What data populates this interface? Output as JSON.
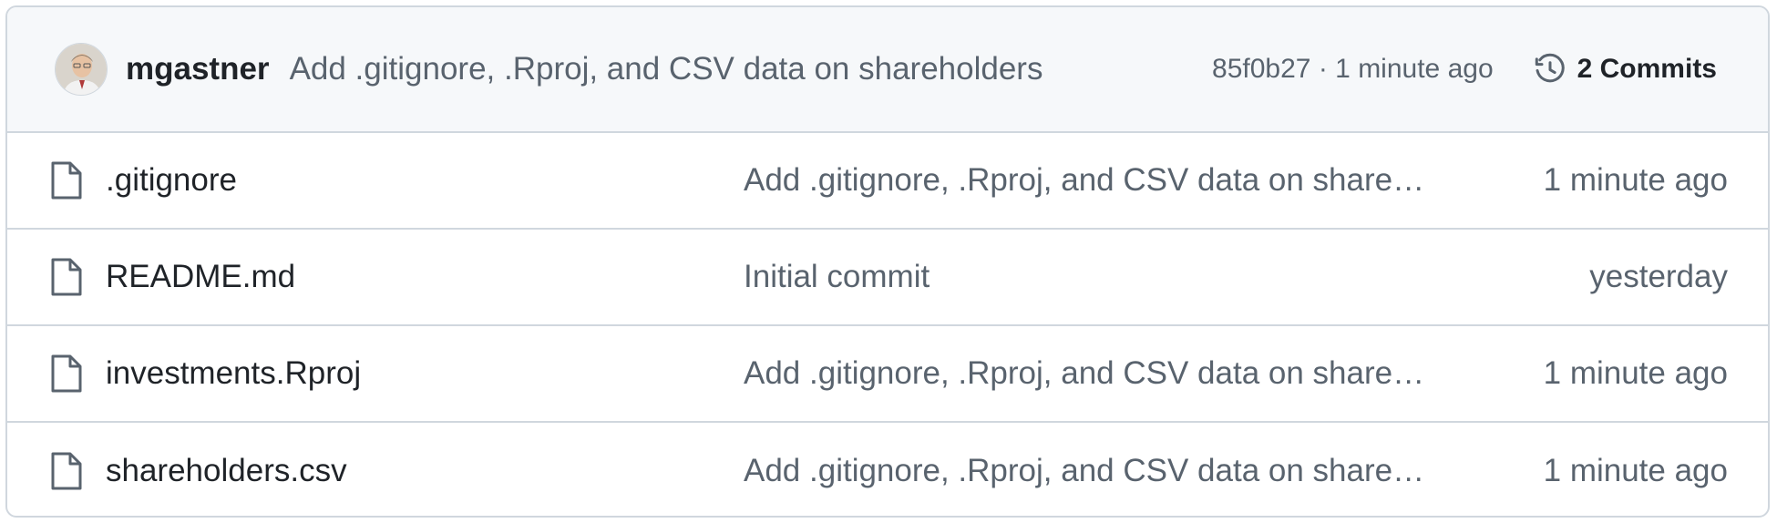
{
  "latest_commit": {
    "author": "mgastner",
    "message": "Add .gitignore, .Rproj, and CSV data on shareholders",
    "sha": "85f0b27",
    "separator": " · ",
    "time": "1 minute ago",
    "commits_count": "2 Commits",
    "avatar_icon": "avatar-photo",
    "history_icon": "history-icon"
  },
  "files": [
    {
      "name": ".gitignore",
      "message": "Add .gitignore, .Rproj, and CSV data on shareholders",
      "time": "1 minute ago",
      "icon": "file-icon"
    },
    {
      "name": "README.md",
      "message": "Initial commit",
      "time": "yesterday",
      "icon": "file-icon"
    },
    {
      "name": "investments.Rproj",
      "message": "Add .gitignore, .Rproj, and CSV data on shareholders",
      "time": "1 minute ago",
      "icon": "file-icon"
    },
    {
      "name": "shareholders.csv",
      "message": "Add .gitignore, .Rproj, and CSV data on shareholders",
      "time": "1 minute ago",
      "icon": "file-icon"
    }
  ],
  "colors": {
    "border": "#d0d7de",
    "header_bg": "#f6f8fa",
    "text_primary": "#1f2328",
    "text_muted": "#59636e"
  }
}
